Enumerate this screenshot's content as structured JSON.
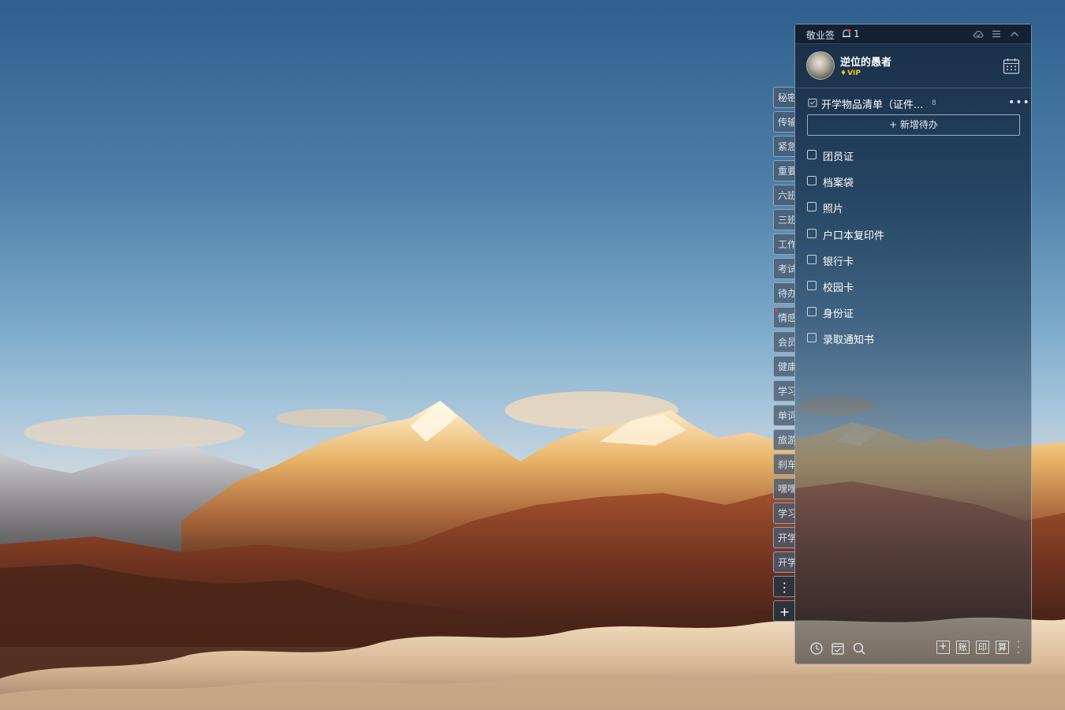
{
  "panel": {
    "app_name": "敬业签",
    "notification_count": "1",
    "user": {
      "name": "逆位的愚者",
      "badge": "VIP"
    },
    "list": {
      "title": "开学物品清单（证件...",
      "count": "8",
      "add_button_label": "+ 新增待办",
      "items": [
        {
          "label": "团员证",
          "checked": false
        },
        {
          "label": "档案袋",
          "checked": false
        },
        {
          "label": "照片",
          "checked": false
        },
        {
          "label": "户口本复印件",
          "checked": false
        },
        {
          "label": "银行卡",
          "checked": false
        },
        {
          "label": "校园卡",
          "checked": false
        },
        {
          "label": "身份证",
          "checked": false
        },
        {
          "label": "录取通知书",
          "checked": false
        }
      ]
    },
    "bottom_toolbar": {
      "icons": [
        "clock-icon",
        "calendar-check-icon",
        "search-icon"
      ],
      "buttons": [
        "+",
        "账",
        "印",
        "算"
      ]
    },
    "accent_color": "#f5c518"
  },
  "side_tabs": {
    "items": [
      "秘密",
      "传输",
      "紧急",
      "重要",
      "六班",
      "三班",
      "工作",
      "考试",
      "待办",
      "情感",
      "会员",
      "健康",
      "学习",
      "单词",
      "旅游",
      "刹车",
      "嘿嘿",
      "学习",
      "开学",
      "开学"
    ],
    "more_label": "⋮",
    "add_label": "+"
  }
}
